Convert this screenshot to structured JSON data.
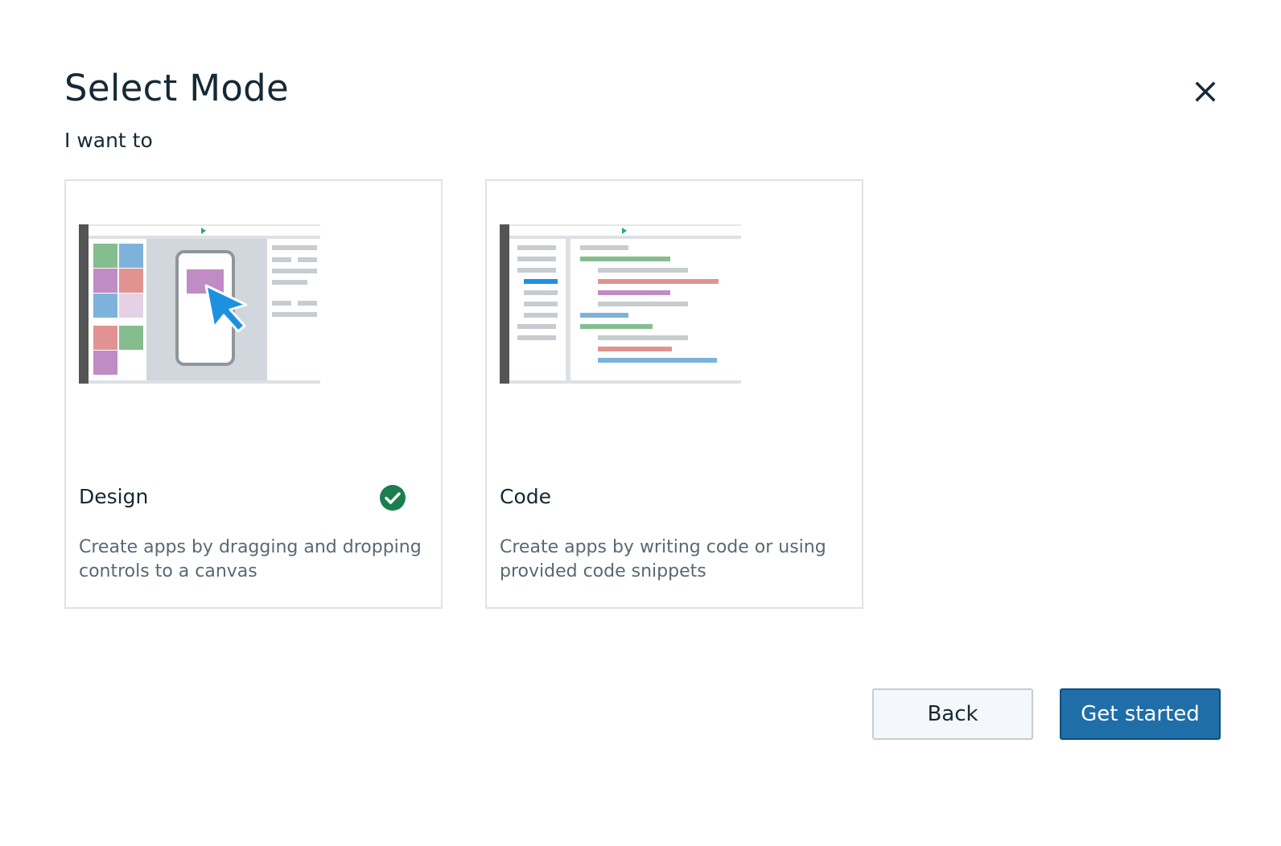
{
  "dialog": {
    "title": "Select Mode",
    "subtitle": "I want to",
    "close_icon": "close-icon"
  },
  "modes": [
    {
      "title": "Design",
      "description": "Create apps by dragging and dropping controls to a canvas",
      "selected": true,
      "illustration": "design-mode-illustration"
    },
    {
      "title": "Code",
      "description": "Create apps by writing code or using provided code snippets",
      "selected": false,
      "illustration": "code-mode-illustration"
    }
  ],
  "footer": {
    "back_label": "Back",
    "start_label": "Get started"
  },
  "colors": {
    "primary": "#1f6ea8",
    "selected_check": "#1b7e4e",
    "text": "#152935",
    "muted_text": "#5a6872",
    "border": "#dfe3e6"
  }
}
